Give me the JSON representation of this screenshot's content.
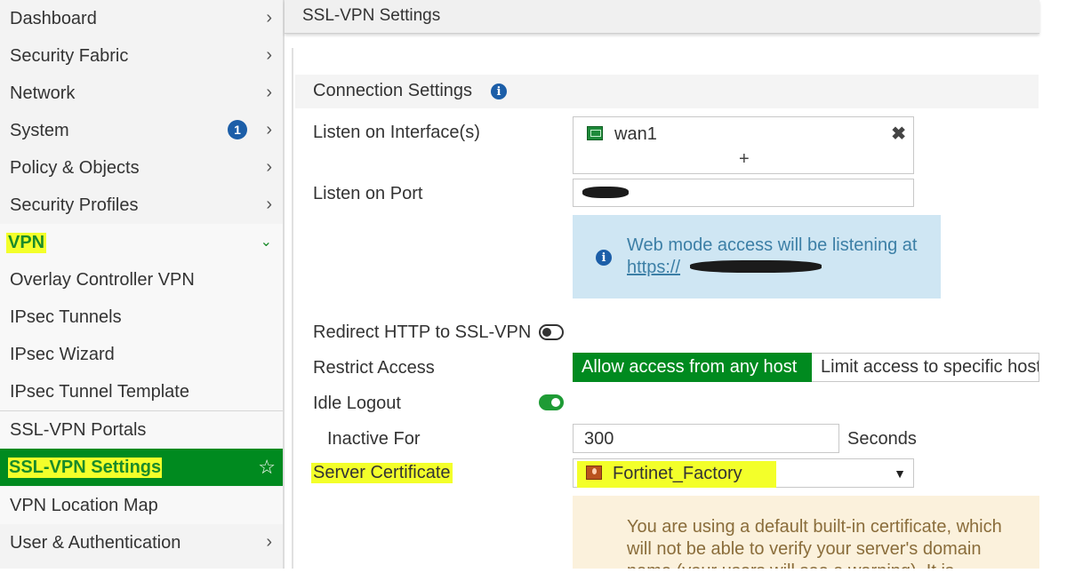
{
  "sidebar": {
    "items": [
      {
        "label": "Dashboard",
        "chevron": "›"
      },
      {
        "label": "Security Fabric",
        "chevron": "›"
      },
      {
        "label": "Network",
        "chevron": "›"
      },
      {
        "label": "System",
        "chevron": "›",
        "badge": "1"
      },
      {
        "label": "Policy & Objects",
        "chevron": "›"
      },
      {
        "label": "Security Profiles",
        "chevron": "›"
      },
      {
        "label": "VPN",
        "chevron": "⌄"
      },
      {
        "label": "Overlay Controller VPN"
      },
      {
        "label": "IPsec Tunnels"
      },
      {
        "label": "IPsec Wizard"
      },
      {
        "label": "IPsec Tunnel Template"
      },
      {
        "label": "SSL-VPN Portals"
      },
      {
        "label": "SSL-VPN Settings",
        "star": "☆"
      },
      {
        "label": "VPN Location Map"
      },
      {
        "label": "User & Authentication",
        "chevron": "›"
      }
    ]
  },
  "header": {
    "title": "SSL-VPN Settings"
  },
  "connection": {
    "section_title": "Connection Settings",
    "info_glyph": "i",
    "listen_interface_label": "Listen on Interface(s)",
    "interface_name": "wan1",
    "remove_glyph": "✖",
    "add_glyph": "+",
    "listen_port_label": "Listen on Port",
    "web_mode_note_line1": "Web mode access will be listening at",
    "web_mode_note_link": "https://",
    "redirect_label": "Redirect HTTP to SSL-VPN",
    "redirect_enabled": false,
    "restrict_label": "Restrict Access",
    "restrict_option_active": "Allow access from any host",
    "restrict_option_other": "Limit access to specific hosts",
    "idle_logout_label": "Idle Logout",
    "idle_logout_enabled": true,
    "inactive_label": "Inactive For",
    "inactive_value": "300",
    "inactive_unit": "Seconds",
    "cert_label": "Server Certificate",
    "cert_value": "Fortinet_Factory",
    "cert_caret": "▼",
    "warning_line1": "You are using a default built-in certificate, which",
    "warning_line2": "will not be able to verify your server's domain",
    "warning_line3": "name (your users will see a warning). It is"
  },
  "colors": {
    "accent_green": "#008a1f",
    "highlight_yellow": "#f3ff2a",
    "info_blue": "#1c5ea8",
    "note_blue_bg": "#cfe6f3",
    "note_warn_bg": "#fbf1dc"
  },
  "icons": {
    "interface": "network-port-icon",
    "certificate": "certificate-icon",
    "info": "info-icon",
    "favorite": "star-icon"
  }
}
